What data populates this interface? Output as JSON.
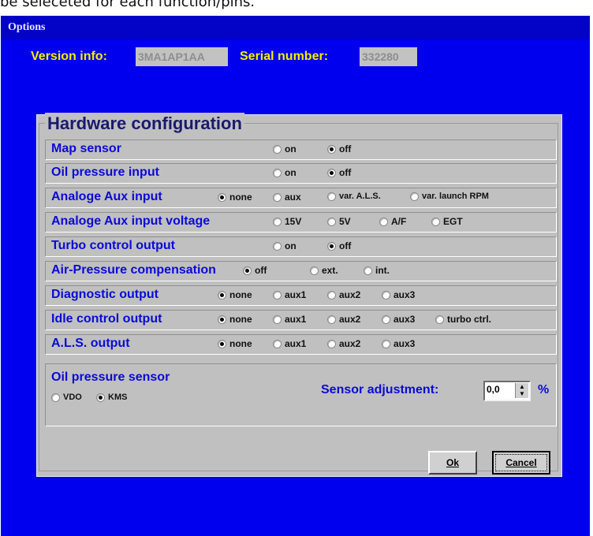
{
  "background_caption": "be seleceted for each function/pins.",
  "window": {
    "title": "Options"
  },
  "info": {
    "version_label": "Version info:",
    "version_value": "3MA1AP1AA",
    "serial_label": "Serial number:",
    "serial_value": "332280"
  },
  "hardware": {
    "title": "Hardware configuration",
    "rows": [
      {
        "label": "Map sensor",
        "options": [
          "on",
          "off"
        ],
        "selected": "off"
      },
      {
        "label": "Oil pressure input",
        "options": [
          "on",
          "off"
        ],
        "selected": "off"
      },
      {
        "label": "Analoge Aux input",
        "options": [
          "none",
          "aux",
          "var. A.L.S.",
          "var. launch RPM"
        ],
        "selected": "none"
      },
      {
        "label": "Analoge Aux input voltage",
        "options": [
          "15V",
          "5V",
          "A/F",
          "EGT"
        ],
        "selected": ""
      },
      {
        "label": "Turbo control output",
        "options": [
          "on",
          "off"
        ],
        "selected": "off"
      },
      {
        "label": "Air-Pressure compensation",
        "options": [
          "off",
          "ext.",
          "int."
        ],
        "selected": "off"
      },
      {
        "label": "Diagnostic output",
        "options": [
          "none",
          "aux1",
          "aux2",
          "aux3"
        ],
        "selected": "none"
      },
      {
        "label": "Idle control output",
        "options": [
          "none",
          "aux1",
          "aux2",
          "aux3",
          "turbo ctrl."
        ],
        "selected": "none"
      },
      {
        "label": "A.L.S. output",
        "options": [
          "none",
          "aux1",
          "aux2",
          "aux3"
        ],
        "selected": "none"
      }
    ]
  },
  "oil_sensor": {
    "title": "Oil pressure sensor",
    "options": [
      "VDO",
      "KMS"
    ],
    "selected": "KMS"
  },
  "sensor_adjustment": {
    "label": "Sensor adjustment:",
    "value": "0,0",
    "unit": "%"
  },
  "buttons": {
    "ok": "Ok",
    "cancel": "Cancel"
  }
}
